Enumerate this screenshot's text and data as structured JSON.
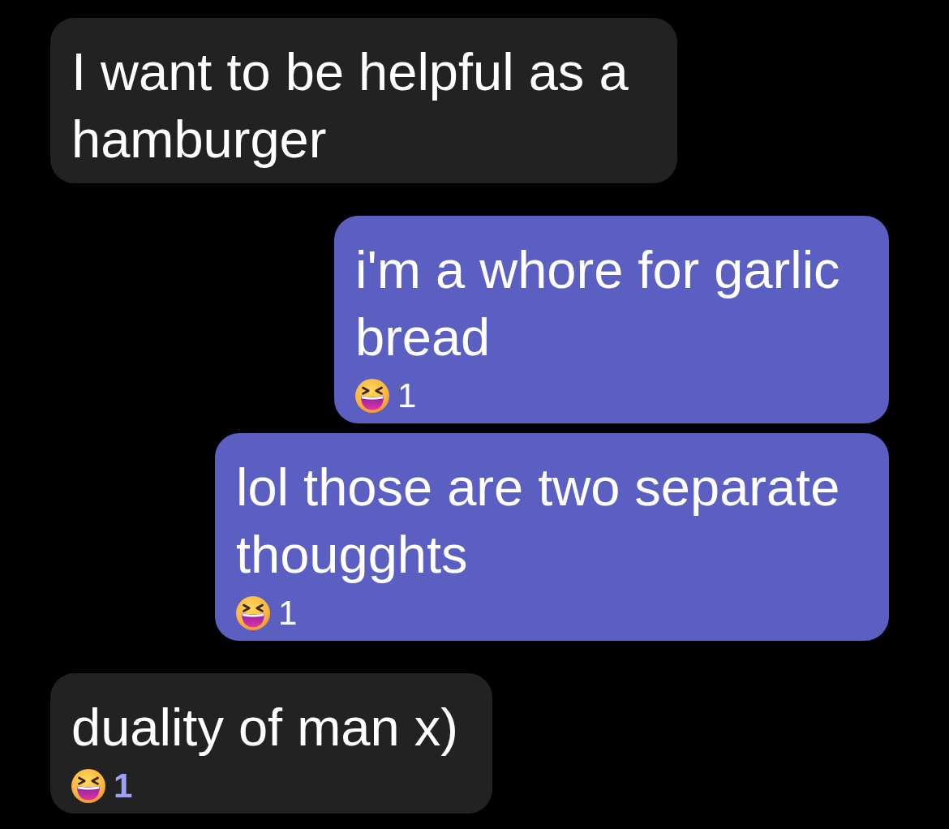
{
  "messages": [
    {
      "kind": "received",
      "text": "I want to be helpful as a hamburger"
    },
    {
      "kind": "sent",
      "text": "i'm a whore for garlic bread",
      "reaction": {
        "count": "1",
        "mine": false
      }
    },
    {
      "kind": "sent",
      "text": "lol those are two separate thougghts",
      "reaction": {
        "count": "1",
        "mine": false
      }
    },
    {
      "kind": "received",
      "text": "duality of man x)",
      "reaction": {
        "count": "1",
        "mine": true
      }
    }
  ]
}
